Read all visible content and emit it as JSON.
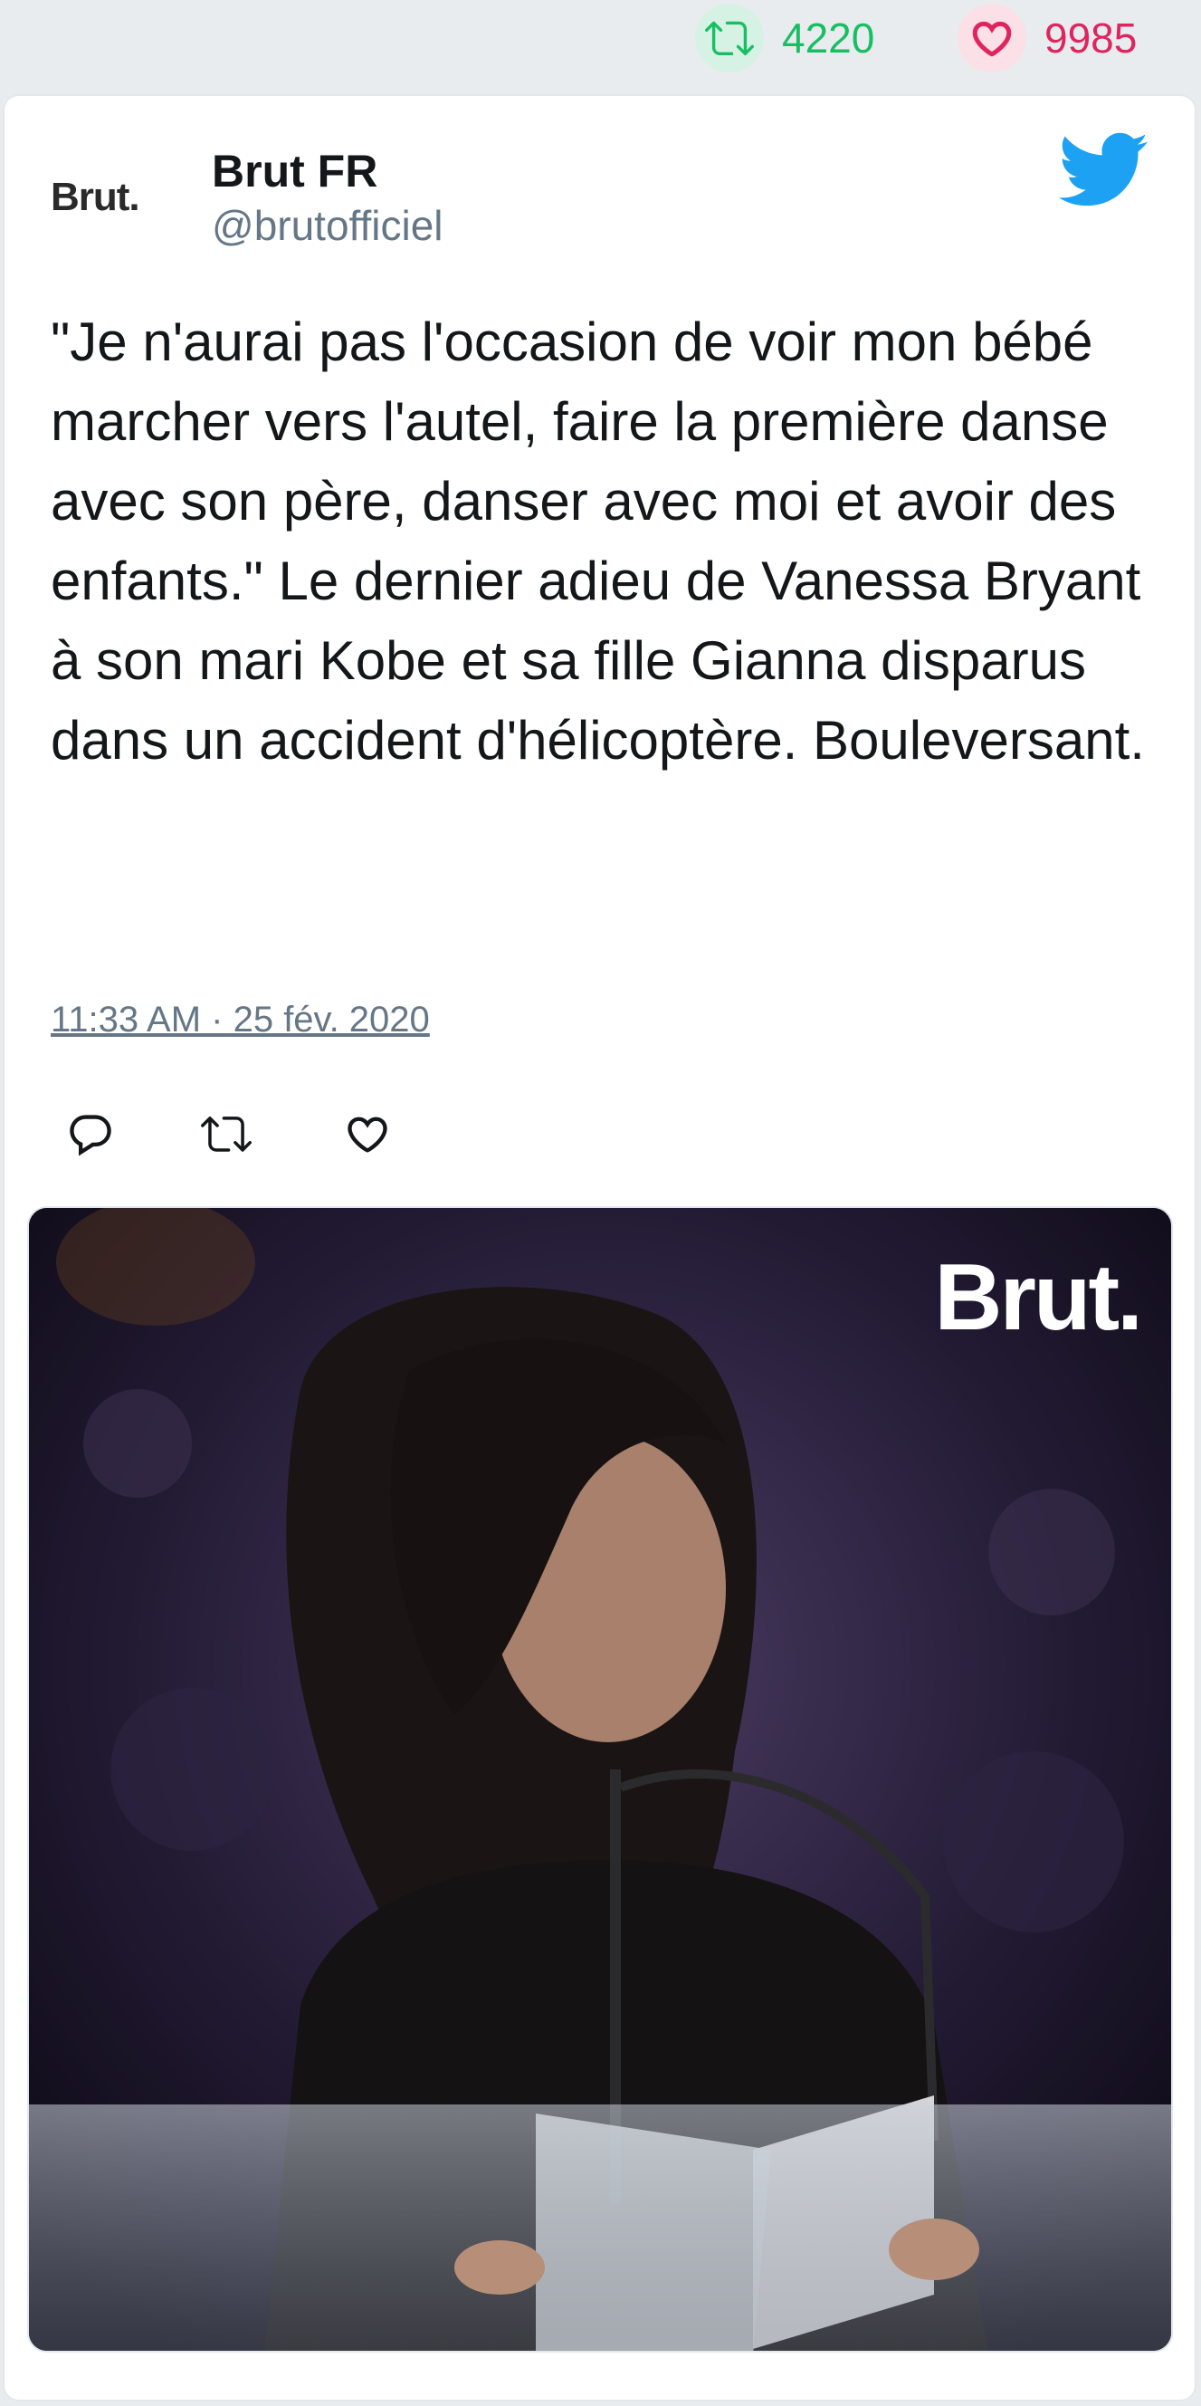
{
  "stats": {
    "retweets": "4220",
    "likes": "9985"
  },
  "author": {
    "avatar_text": "Brut.",
    "name": "Brut FR",
    "handle": "@brutofficiel"
  },
  "tweet": {
    "text": "\"Je n'aurai pas l'occasion de voir mon bébé marcher vers l'autel, faire la première danse avec son père, danser avec moi et avoir des enfants.\" Le dernier adieu de Vanessa Bryant à son mari Kobe et sa fille Gianna disparus dans un accident d'hélicoptère. Bouleversant.",
    "timestamp": "11:33 AM · 25 fév. 2020"
  },
  "media": {
    "watermark": "Brut."
  },
  "icons": {
    "retweet_stat": "retweet-icon",
    "like_stat": "heart-icon",
    "brand": "twitter-bird-icon",
    "reply": "reply-icon",
    "retweet": "retweet-icon",
    "like": "heart-icon"
  },
  "colors": {
    "retweet": "#17bf63",
    "like": "#e0245e",
    "twitter_blue": "#1da1f2",
    "muted": "#657786"
  }
}
